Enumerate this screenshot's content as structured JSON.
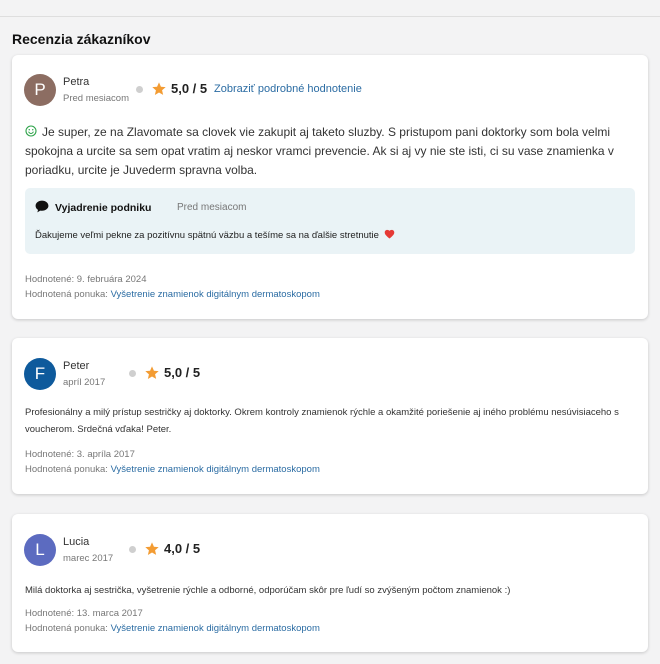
{
  "section_title": "Recenzia zákazníkov",
  "reviews": [
    {
      "initial": "P",
      "avatar_color": "#8c6d62",
      "name": "Petra",
      "time": "Pred mesiacom",
      "rating": "5,0 / 5",
      "detail_link": "Zobraziť podrobné hodnotenie",
      "text": "Je super, ze na Zlavomate sa clovek vie zakupit aj taketo sluzby. S pristupom pani doktorky som bola velmi spokojna a urcite sa sem opat vratim aj neskor vramci prevencie. Ak si aj vy nie ste isti, ci su vase znamienka v poriadku, urcite je Juvederm spravna volba.",
      "reply_title": "Vyjadrenie podniku",
      "reply_time": "Pred mesiacom",
      "reply_text": "Ďakujeme veľmi pekne za pozitívnu spätnú väzbu a tešíme sa na ďalšie stretnutie",
      "rated_label": "Hodnotené: 9. februára 2024",
      "offer_label": "Hodnotená ponuka:",
      "offer_link": "Vyšetrenie znamienok digitálnym dermatoskopom"
    },
    {
      "initial": "F",
      "avatar_color": "#0e5a9c",
      "name": "Peter",
      "time": "apríl 2017",
      "rating": "5,0 / 5",
      "text": "Profesionálny a milý prístup sestričky aj doktorky. Okrem kontroly znamienok rýchle a okamžité poriešenie aj iného problému nesúvisiaceho s voucherom. Srdečná vďaka! Peter.",
      "rated_label": "Hodnotené: 3. apríla 2017",
      "offer_label": "Hodnotená ponuka:",
      "offer_link": "Vyšetrenie znamienok digitálnym dermatoskopom"
    },
    {
      "initial": "L",
      "avatar_color": "#5c6bc0",
      "name": "Lucia",
      "time": "marec 2017",
      "rating": "4,0 / 5",
      "text": "Milá doktorka aj sestrička, vyšetrenie rýchle a odborné, odporúčam skôr pre ľudí so zvýšeným počtom znamienok :)",
      "rated_label": "Hodnotené: 13. marca 2017",
      "offer_label": "Hodnotená ponuka:",
      "offer_link": "Vyšetrenie znamienok digitálnym dermatoskopom"
    }
  ],
  "icons": {
    "star": "star-icon",
    "smile": "smile-icon",
    "reply": "speech-bubble-icon",
    "heart": "heart-icon"
  },
  "colors": {
    "star": "#f39c33",
    "link": "#2b6ca3",
    "reply_bg": "#eaf3f6",
    "smile": "#2ea34a",
    "heart": "#e53935"
  }
}
